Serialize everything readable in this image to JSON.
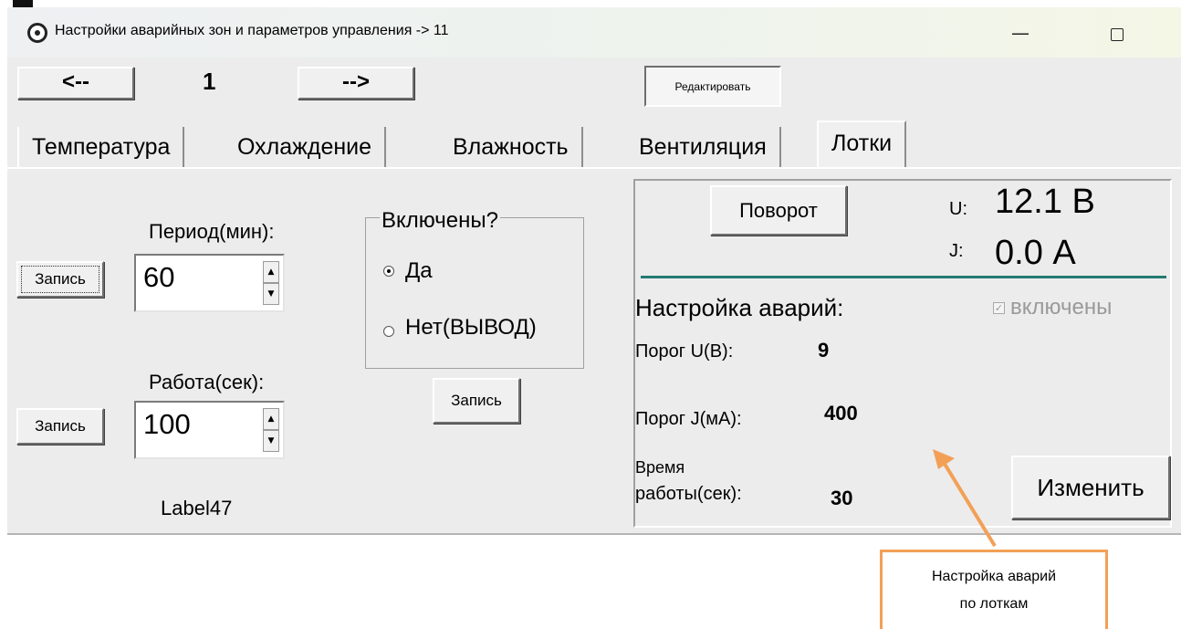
{
  "window": {
    "title": "Настройки аварийных зон и параметров управления -> 11",
    "minimize_glyph": "—"
  },
  "toolbar": {
    "prev_label": "<--",
    "page_number": "1",
    "next_label": "-->",
    "edit_label": "Редактировать"
  },
  "tabs": [
    {
      "label": "Температура"
    },
    {
      "label": "Охлаждение"
    },
    {
      "label": "Влажность"
    },
    {
      "label": "Вентиляция"
    },
    {
      "label": "Лотки",
      "active": true
    }
  ],
  "left": {
    "period_label": "Период(мин):",
    "period_value": "60",
    "work_label": "Работа(сек):",
    "work_value": "100",
    "write_label": "Запись",
    "footer_label": "Label47",
    "group_title": "Включены?",
    "radio_yes": "Да",
    "radio_no": "Нет(ВЫВОД)",
    "selected": "Да"
  },
  "right": {
    "rotate_label": "Поворот",
    "u_label": "U:",
    "u_value": "12.1 В",
    "j_label": "J:",
    "j_value": "0.0 А",
    "alarm_header": "Настройка аварий:",
    "enabled_label": "включены",
    "enabled_checked": true,
    "u_threshold_label": "Порог U(В):",
    "u_threshold_value": "9",
    "j_threshold_label": "Порог J(мА):",
    "j_threshold_value": "400",
    "worktime_label_1": "Время",
    "worktime_label_2": "работы(сек):",
    "worktime_value": "30",
    "change_label": "Изменить"
  },
  "callout": {
    "line1": "Настройка аварий",
    "line2": "по лоткам"
  },
  "colors": {
    "accent_line": "#237a72",
    "callout_border": "#f2a057"
  }
}
